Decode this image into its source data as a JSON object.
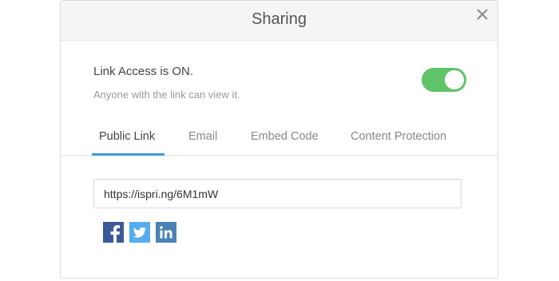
{
  "dialog": {
    "title": "Sharing",
    "close_icon": "close-icon"
  },
  "access": {
    "title": "Link Access is ON.",
    "subtitle": "Anyone with the link can view it.",
    "toggle_on": true,
    "toggle_color": "#5fc36a"
  },
  "tabs": [
    {
      "label": "Public Link",
      "active": true
    },
    {
      "label": "Email",
      "active": false
    },
    {
      "label": "Embed Code",
      "active": false
    },
    {
      "label": "Content Protection",
      "active": false
    }
  ],
  "accent_color": "#3a9fd8",
  "public_link": {
    "value": "https://ispri.ng/6M1mW"
  },
  "share_buttons": [
    {
      "icon": "facebook-icon",
      "color": "#3b5998"
    },
    {
      "icon": "twitter-icon",
      "color": "#55acee"
    },
    {
      "icon": "linkedin-icon",
      "color": "#4b82b4"
    }
  ]
}
